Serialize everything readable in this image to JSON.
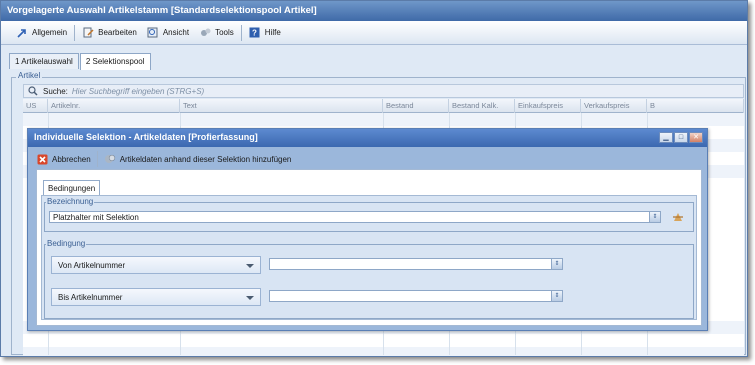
{
  "window": {
    "title": "Vorgelagerte Auswahl Artikelstamm [Standardselektionspool Artikel]"
  },
  "menubar": {
    "items": [
      {
        "label": "Allgemein",
        "icon": "arrow-icon"
      },
      {
        "label": "Bearbeiten",
        "icon": "edit-icon"
      },
      {
        "label": "Ansicht",
        "icon": "view-icon"
      },
      {
        "label": "Tools",
        "icon": "tools-icon"
      },
      {
        "label": "Hilfe",
        "icon": "help-icon"
      }
    ]
  },
  "tabs": [
    {
      "label": "1 Artikelauswahl"
    },
    {
      "label": "2 Selektionspool"
    }
  ],
  "artikel": {
    "legend": "Artikel",
    "search_label": "Suche:",
    "search_placeholder": "Hier Suchbegriff eingeben (STRG+S)",
    "columns": [
      "US",
      "Artikelnr.",
      "Text",
      "Bestand",
      "Bestand Kalk.",
      "Einkaufspreis",
      "Verkaufspreis",
      "B"
    ]
  },
  "dialog": {
    "title": "Individuelle Selektion - Artikeldaten [Profierfassung]",
    "cancel_label": "Abbrechen",
    "add_label": "Artikeldaten anhand dieser Selektion hinzufügen",
    "tab_label": "Bedingungen",
    "bezeichnung": {
      "legend": "Bezeichnung",
      "value": "Platzhalter mit Selektion"
    },
    "bedingung": {
      "legend": "Bedingung",
      "from_label": "Von Artikelnummer",
      "from_value": "",
      "to_label": "Bis Artikelnummer",
      "to_value": ""
    }
  },
  "colors": {
    "title_bar": "#3f6aa8",
    "dialog_title": "#3b68b0",
    "accent": "#3a5f93"
  }
}
